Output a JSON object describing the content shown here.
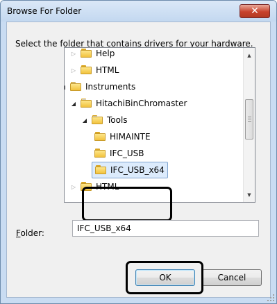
{
  "window": {
    "title": "Browse For Folder",
    "close_icon": "close-icon"
  },
  "instruction": "Select the folder that contains drivers for your hardware.",
  "tree": {
    "items": [
      {
        "label": "Help",
        "expander": "collapsed"
      },
      {
        "label": "HTML",
        "expander": "collapsed"
      },
      {
        "label": "Instruments",
        "expander": "expanded"
      },
      {
        "label": "HitachiBinChromaster",
        "expander": "expanded"
      },
      {
        "label": "Tools",
        "expander": "expanded"
      },
      {
        "label": "HIMAINTE",
        "expander": "none"
      },
      {
        "label": "IFC_USB",
        "expander": "none"
      },
      {
        "label": "IFC_USB_x64",
        "expander": "none",
        "selected": true
      },
      {
        "label": "HTML",
        "expander": "collapsed"
      }
    ]
  },
  "folder_field": {
    "label_prefix": "F",
    "label_rest": "older:",
    "value": "IFC_USB_x64"
  },
  "buttons": {
    "ok": "OK",
    "cancel": "Cancel"
  },
  "colors": {
    "title_bar": "#c9dcf2",
    "close_button": "#c8422c",
    "selection": "#dcebfc",
    "folder": "#f2c23d"
  }
}
